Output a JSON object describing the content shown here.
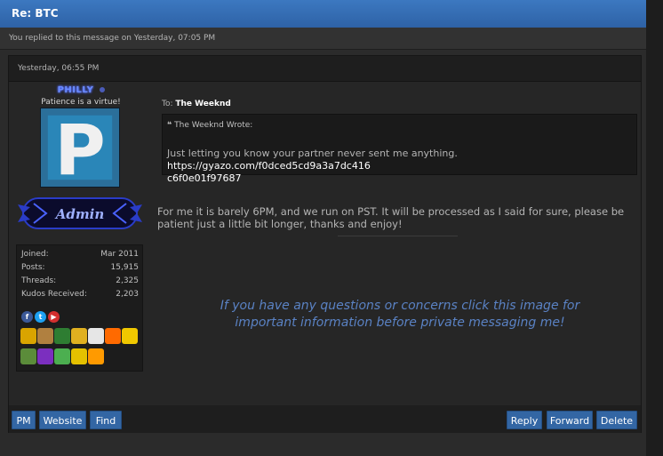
{
  "header": {
    "title": "Re: BTC"
  },
  "notice": {
    "text": "You replied to this message on Yesterday, 07:05 PM"
  },
  "post": {
    "date": "Yesterday, 06:55 PM",
    "author": {
      "username": "PHILLY",
      "user_title": "Patience is a virtue!",
      "avatar_letter": "P",
      "rank_label": "Admin",
      "stats": [
        {
          "label": "Joined:",
          "value": "Mar 2011"
        },
        {
          "label": "Posts:",
          "value": "15,915"
        },
        {
          "label": "Threads:",
          "value": "2,325"
        },
        {
          "label": "Kudos Received:",
          "value": "2,203"
        }
      ],
      "social": [
        {
          "icon": "facebook-icon",
          "glyph": "f",
          "color": "#3b5998"
        },
        {
          "icon": "twitter-icon",
          "glyph": "t",
          "color": "#1da1f2"
        },
        {
          "icon": "youtube-icon",
          "glyph": "▶",
          "color": "#d32f2f"
        }
      ],
      "badges": [
        {
          "icon": "mushroom-badge-icon",
          "color": "#d9a400"
        },
        {
          "icon": "mug-badge-icon",
          "color": "#b08040"
        },
        {
          "icon": "billiards-badge-icon",
          "color": "#2e7d32"
        },
        {
          "icon": "diamond-badge-icon",
          "color": "#e0b020"
        },
        {
          "icon": "dice-badge-icon",
          "color": "#e6e6e6"
        },
        {
          "icon": "fire-badge-icon",
          "color": "#ff6a00"
        },
        {
          "icon": "star-badge-icon",
          "color": "#f0c800"
        },
        {
          "icon": "zombie-badge-icon",
          "color": "#5b8c3a"
        },
        {
          "icon": "gem-badge-icon",
          "color": "#7b2fbf"
        },
        {
          "icon": "link-badge-icon",
          "color": "#4caf50"
        },
        {
          "icon": "triforce-badge-icon",
          "color": "#e5c100"
        },
        {
          "icon": "honey-badge-icon",
          "color": "#ff9a00"
        }
      ]
    },
    "to_label": "To:",
    "recipient": "The Weeknd",
    "quote": {
      "author_line": "The Weeknd Wrote:",
      "text": "Just letting you know your partner never sent me anything.",
      "link_line1": "https://gyazo.com/f0dced5cd9a3a7dc416",
      "link_line2": "c6f0e01f97687"
    },
    "message": "For me it is barely 6PM, and we run on PST. It will be processed as I said for sure, please be patient just a little bit longer, thanks and enjoy!",
    "signature": {
      "line1": "If you have any questions or concerns click this image for",
      "line2": "important information before private messaging me!"
    },
    "actions_left": [
      "PM",
      "Website",
      "Find"
    ],
    "actions_right": [
      "Reply",
      "Forward",
      "Delete"
    ]
  }
}
